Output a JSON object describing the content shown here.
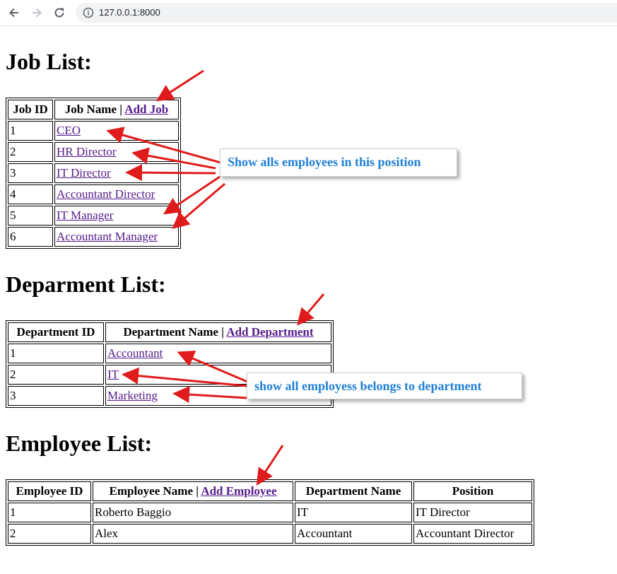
{
  "browser": {
    "url": "127.0.0.1:8000",
    "icons": [
      "back-arrow-icon",
      "forward-arrow-icon",
      "reload-icon",
      "info-icon"
    ]
  },
  "jobs": {
    "title": "Job List:",
    "headers": {
      "id": "Job ID",
      "name": "Job Name | ",
      "add_link": "Add Job"
    },
    "rows": [
      {
        "id": "1",
        "name": "CEO"
      },
      {
        "id": "2",
        "name": "HR Director"
      },
      {
        "id": "3",
        "name": "IT Director"
      },
      {
        "id": "4",
        "name": "Accountant Director"
      },
      {
        "id": "5",
        "name": "IT Manager"
      },
      {
        "id": "6",
        "name": "Accountant Manager"
      }
    ]
  },
  "departments": {
    "title": "Deparment List:",
    "headers": {
      "id": "Department ID",
      "name": "Department Name | ",
      "add_link": "Add Department"
    },
    "rows": [
      {
        "id": "1",
        "name": "Accountant"
      },
      {
        "id": "2",
        "name": "IT"
      },
      {
        "id": "3",
        "name": "Marketing"
      }
    ]
  },
  "employees": {
    "title": "Employee List:",
    "headers": {
      "id": "Employee ID",
      "name": "Employee Name | ",
      "add_link": "Add Employee",
      "department": "Department Name",
      "position": "Position"
    },
    "rows": [
      {
        "id": "1",
        "name": "Roberto Baggio",
        "department": "IT",
        "position": "IT Director"
      },
      {
        "id": "2",
        "name": "Alex",
        "department": "Accountant",
        "position": "Accountant Director"
      }
    ]
  },
  "annotations": {
    "job_callout": "Show alls employees in this position",
    "dept_callout": "show all employess belongs to department",
    "callout_color": "#1e7fd6",
    "arrow_color": "#e01b1b"
  },
  "colors": {
    "link": "#551a8b",
    "text": "#000000",
    "background": "#ffffff"
  }
}
